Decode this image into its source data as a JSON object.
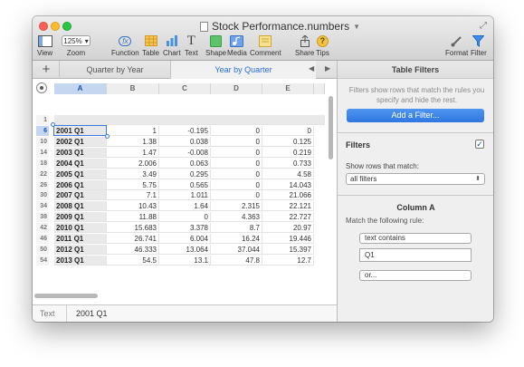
{
  "window": {
    "title": "Stock Performance.numbers"
  },
  "toolbar": {
    "view": "View",
    "zoom_value": "125%",
    "zoom": "Zoom",
    "function": "Function",
    "function_icon_text": "fx",
    "table": "Table",
    "chart": "Chart",
    "text": "Text",
    "text_icon_text": "T",
    "shape": "Shape",
    "media": "Media",
    "comment": "Comment",
    "share": "Share",
    "tips": "Tips",
    "tips_icon_text": "?",
    "format": "Format",
    "filter": "Filter"
  },
  "tabbar": {
    "add": "+",
    "tabs": [
      "Quarter by Year",
      "Year by Quarter"
    ],
    "nav_left": "◀",
    "nav_right": "▶"
  },
  "sheet": {
    "columns": [
      "A",
      "B",
      "C",
      "D",
      "E"
    ],
    "header_row_number": "1",
    "rows": [
      {
        "num": "6",
        "cells": [
          "2001 Q1",
          "1",
          "-0.195",
          "0",
          "0"
        ]
      },
      {
        "num": "10",
        "cells": [
          "2002 Q1",
          "1.38",
          "0.038",
          "0",
          "0.125"
        ]
      },
      {
        "num": "14",
        "cells": [
          "2003 Q1",
          "1.47",
          "-0.008",
          "0",
          "0.219"
        ]
      },
      {
        "num": "18",
        "cells": [
          "2004 Q1",
          "2.006",
          "0.063",
          "0",
          "0.733"
        ]
      },
      {
        "num": "22",
        "cells": [
          "2005 Q1",
          "3.49",
          "0.295",
          "0",
          "4.58"
        ]
      },
      {
        "num": "26",
        "cells": [
          "2006 Q1",
          "5.75",
          "0.565",
          "0",
          "14.043"
        ]
      },
      {
        "num": "30",
        "cells": [
          "2007 Q1",
          "7.1",
          "1.011",
          "0",
          "21.066"
        ]
      },
      {
        "num": "34",
        "cells": [
          "2008 Q1",
          "10.43",
          "1.64",
          "2.315",
          "22.121"
        ]
      },
      {
        "num": "38",
        "cells": [
          "2009 Q1",
          "11.88",
          "0",
          "4.363",
          "22.727"
        ]
      },
      {
        "num": "42",
        "cells": [
          "2010 Q1",
          "15.683",
          "3.378",
          "8.7",
          "20.97"
        ]
      },
      {
        "num": "46",
        "cells": [
          "2011 Q1",
          "26.741",
          "6.004",
          "16.24",
          "19.446"
        ]
      },
      {
        "num": "50",
        "cells": [
          "2012 Q1",
          "46.333",
          "13.064",
          "37.044",
          "15.397"
        ]
      },
      {
        "num": "54",
        "cells": [
          "2013 Q1",
          "54.5",
          "13.1",
          "47.8",
          "12.7"
        ]
      }
    ]
  },
  "status": {
    "type": "Text",
    "value": "2001 Q1"
  },
  "inspector": {
    "title": "Table Filters",
    "description": "Filters show rows that match the rules you specify and hide the rest.",
    "add_filter": "Add a Filter...",
    "filters_label": "Filters",
    "filters_checked": "✓",
    "show_rows_label": "Show rows that match:",
    "show_rows_value": "all filters",
    "column_heading": "Column A",
    "match_rule_label": "Match the following rule:",
    "rule_operator": "text contains",
    "rule_value": "Q1",
    "or_button": "or..."
  },
  "colors": {
    "accent": "#2f77e0",
    "selection": "#3b7ae3"
  }
}
